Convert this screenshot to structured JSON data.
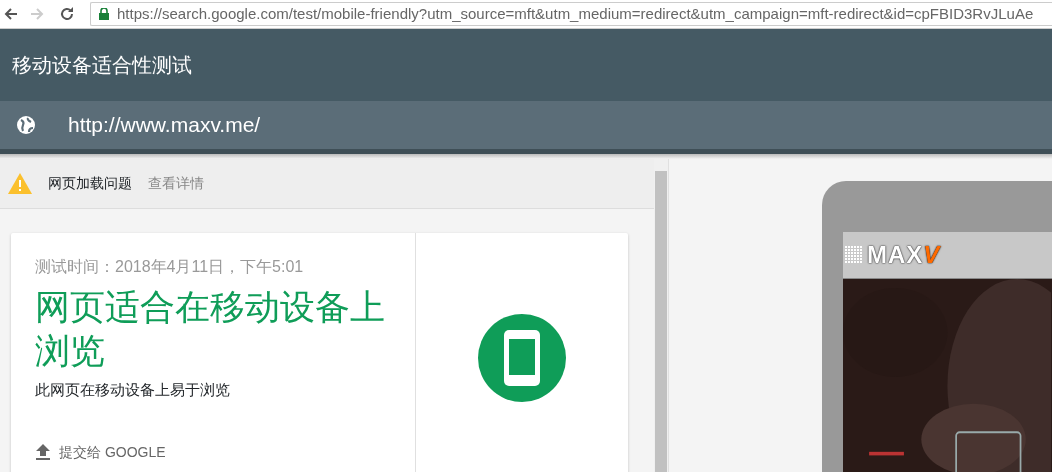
{
  "browser": {
    "url": "https://search.google.com/test/mobile-friendly?utm_source=mft&utm_medium=redirect&utm_campaign=mft-redirect&id=cpFBID3RvJLuAe",
    "secure": true,
    "back_enabled": true,
    "forward_enabled": false
  },
  "header": {
    "title": "移动设备适合性测试"
  },
  "url_bar": {
    "value": "http://www.maxv.me/"
  },
  "warning": {
    "text": "网页加载问题",
    "link": "查看详情"
  },
  "result": {
    "tested_at": "测试时间：2018年4月11日，下午5:01",
    "headline": "网页适合在移动设备上浏览",
    "description": "此网页在移动设备上易于浏览",
    "submit": "提交给 GOOGLE"
  },
  "preview": {
    "logo_text": "MAX",
    "logo_accent": "V",
    "kind": "picture"
  }
}
